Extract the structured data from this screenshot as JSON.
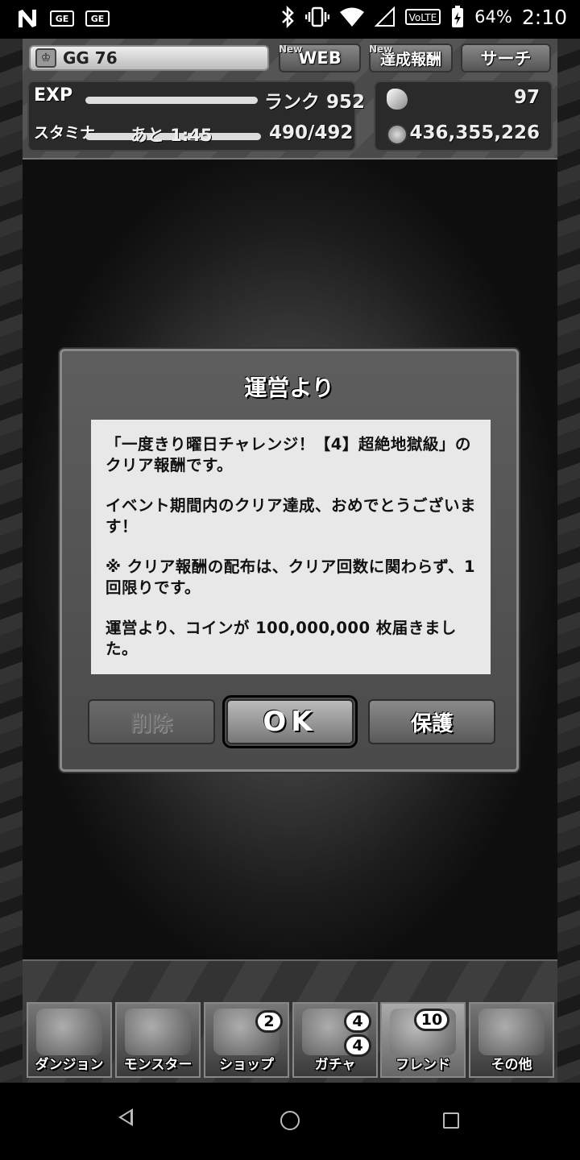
{
  "status_bar": {
    "icons": [
      "n-icon",
      "ge-icon",
      "ge-icon",
      "bluetooth-icon",
      "vibrate-icon",
      "wifi-icon",
      "signal-icon"
    ],
    "ge_label": "GE",
    "volte_label": "VoLTE",
    "battery_pct": "64%",
    "time": "2:10"
  },
  "hud": {
    "player_name": "GG 76",
    "buttons": {
      "web": "WEB",
      "achievement": "達成報酬",
      "search": "サーチ"
    },
    "new_tag": "New",
    "exp_label": "EXP",
    "rank_text": "ランク 952",
    "stamina_label": "スタミナ",
    "stamina_timer": "あと 1:45",
    "stamina_value": "490/492",
    "magic_stones": "97",
    "coins": "436,355,226"
  },
  "dialog": {
    "title": "運営より",
    "paragraphs": [
      "「一度きり曜日チャレンジ！【4】超絶地獄級」のクリア報酬です。",
      "イベント期間内のクリア達成、おめでとうございます！",
      "※ クリア報酬の配布は、クリア回数に関わらず、1回限りです。",
      "運営より、コインが 100,000,000 枚届きました。"
    ],
    "delete_label": "削除",
    "ok_label": "OK",
    "protect_label": "保護"
  },
  "nav": {
    "tabs": [
      {
        "label": "ダンジョン",
        "badge": ""
      },
      {
        "label": "モンスター",
        "badge": ""
      },
      {
        "label": "ショップ",
        "badge": "2"
      },
      {
        "label": "ガチャ",
        "badge": "4",
        "badge2": "4"
      },
      {
        "label": "フレンド",
        "badge": "10"
      },
      {
        "label": "その他",
        "badge": ""
      }
    ]
  }
}
